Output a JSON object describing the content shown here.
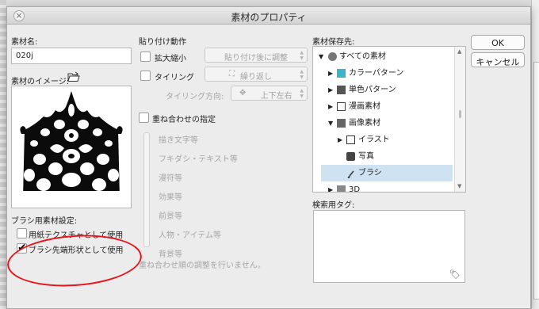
{
  "window": {
    "title": "素材のプロパティ"
  },
  "material_name": {
    "label": "素材名:",
    "value": "020j"
  },
  "material_image": {
    "label": "素材のイメージ:"
  },
  "brush_settings": {
    "label": "ブラシ用素材設定:",
    "paper_texture": {
      "label": "用紙テクスチャとして使用",
      "checked": false
    },
    "brush_tip": {
      "label": "ブラシ先端形状として使用",
      "checked": true
    }
  },
  "paste_behavior": {
    "label": "貼り付け動作",
    "scale": {
      "label": "拡大縮小",
      "checked": false,
      "value": "貼り付け後に調整"
    },
    "tiling": {
      "label": "タイリング",
      "checked": false,
      "value": "繰り返し"
    },
    "tiling_direction": {
      "label": "タイリング方向:",
      "value": "上下左右"
    }
  },
  "overlap": {
    "label": "重ね合わせの指定",
    "checked": false,
    "items": [
      "描き文字等",
      "フキダシ・テキスト等",
      "漫符等",
      "効果等",
      "前景等",
      "人物・アイテム等",
      "背景等"
    ],
    "note": "重ね合わせ順の調整を行いません。"
  },
  "save_location": {
    "label": "素材保存先:",
    "items": [
      {
        "label": "すべての素材",
        "icon": "circle-icon",
        "expanded": true
      },
      {
        "label": "カラーパターン",
        "icon": "color-pattern-icon",
        "expanded": false
      },
      {
        "label": "単色パターン",
        "icon": "mono-pattern-icon",
        "expanded": false
      },
      {
        "label": "漫画素材",
        "icon": "manga-icon",
        "expanded": false
      },
      {
        "label": "画像素材",
        "icon": "image-icon",
        "expanded": true
      },
      {
        "label": "イラスト",
        "icon": "illustration-icon",
        "expanded": false
      },
      {
        "label": "写真",
        "icon": "camera-icon"
      },
      {
        "label": "ブラシ",
        "icon": "brush-icon",
        "selected": true
      },
      {
        "label": "3D",
        "icon": "3d-icon"
      }
    ]
  },
  "search_tags": {
    "label": "検索用タグ:"
  },
  "buttons": {
    "ok": "OK",
    "cancel": "キャンセル"
  },
  "colors": {
    "annotation": "#e8141c",
    "selection": "#cfe2f2"
  }
}
